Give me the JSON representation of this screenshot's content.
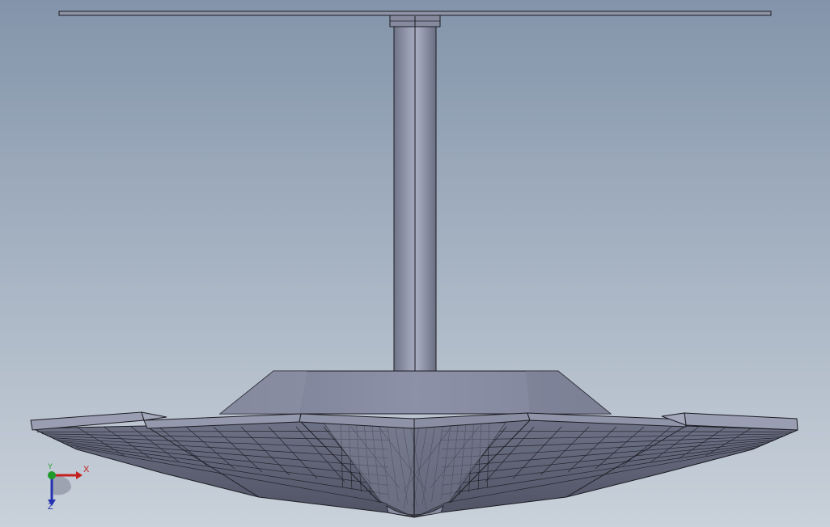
{
  "viewport": {
    "background_top": "#8394aa",
    "background_bottom": "#c9d1da",
    "model_color": "#8c90a6",
    "edge_color": "#1c1c22"
  },
  "model": {
    "parts": [
      "top-plate",
      "mount-flange",
      "support-column",
      "base-plinth",
      "petal-rim",
      "petal-underside-mesh",
      "center-hub"
    ]
  },
  "triad": {
    "x_label": "X",
    "y_label": "Y",
    "z_label": "Z",
    "x_color": "#c42020",
    "y_color": "#1f9a2a",
    "z_color": "#2532b0"
  }
}
